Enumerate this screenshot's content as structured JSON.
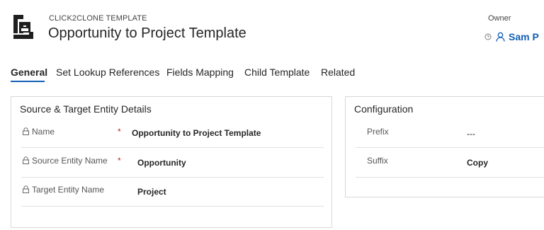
{
  "header": {
    "entity_type": "CLICK2CLONE TEMPLATE",
    "title": "Opportunity to Project Template",
    "owner_label": "Owner",
    "owner_name": "Sam P"
  },
  "tabs": [
    {
      "label": "General",
      "active": true
    },
    {
      "label": "Set Lookup References",
      "active": false
    },
    {
      "label": "Fields Mapping",
      "active": false
    },
    {
      "label": "Child Template",
      "active": false
    },
    {
      "label": "Related",
      "active": false
    }
  ],
  "source_target_section": {
    "title": "Source & Target Entity Details",
    "fields": [
      {
        "label": "Name",
        "required": "*",
        "value": "Opportunity to Project Template"
      },
      {
        "label": "Source Entity Name",
        "required": "*",
        "value": "Opportunity"
      },
      {
        "label": "Target Entity Name",
        "required": "",
        "value": "Project"
      }
    ]
  },
  "configuration_section": {
    "title": "Configuration",
    "fields": [
      {
        "label": "Prefix",
        "value": "---"
      },
      {
        "label": "Suffix",
        "value": "Copy"
      }
    ]
  },
  "colors": {
    "accent": "#1160b7",
    "required": "#c0272d",
    "border": "#d8d8d8"
  },
  "icons": {
    "entity": "template-clone-icon",
    "lock": "lock-icon",
    "clock": "clock-icon",
    "owner": "person-icon"
  }
}
